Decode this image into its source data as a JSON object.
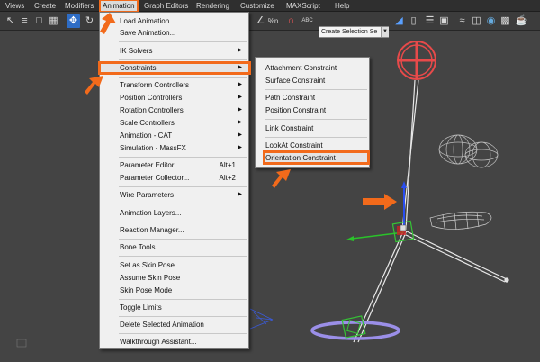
{
  "menubar": {
    "items": [
      "Views",
      "Create",
      "Modifiers",
      "Animation",
      "Graph Editors",
      "Rendering",
      "Customize",
      "MAXScript",
      "Help"
    ]
  },
  "toolbar": {
    "selection_set_placeholder": "Create Selection Se",
    "icons": [
      "select-icon",
      "region-icon",
      "move-icon",
      "rotate-icon",
      "named-selection-icon",
      "mirror-icon",
      "align-icon",
      "layers-icon",
      "graphite-icon",
      "curve-editor-icon",
      "schematic-icon",
      "material-editor-icon",
      "render-setup-icon",
      "render-frame-icon",
      "render-icon"
    ],
    "percent_snap": "%n",
    "spinner_snap": "ABC"
  },
  "animation_menu": {
    "items": [
      {
        "label": "Load Animation...",
        "shortcut": "",
        "submenu": false
      },
      {
        "label": "Save Animation...",
        "shortcut": "",
        "submenu": false
      },
      {
        "label": "IK Solvers",
        "shortcut": "",
        "submenu": true
      },
      {
        "label": "Constraints",
        "shortcut": "",
        "submenu": true
      },
      {
        "label": "Transform Controllers",
        "shortcut": "",
        "submenu": true
      },
      {
        "label": "Position Controllers",
        "shortcut": "",
        "submenu": true
      },
      {
        "label": "Rotation Controllers",
        "shortcut": "",
        "submenu": true
      },
      {
        "label": "Scale Controllers",
        "shortcut": "",
        "submenu": true
      },
      {
        "label": "Animation - CAT",
        "shortcut": "",
        "submenu": true
      },
      {
        "label": "Simulation - MassFX",
        "shortcut": "",
        "submenu": true
      },
      {
        "label": "Parameter Editor...",
        "shortcut": "Alt+1",
        "submenu": false
      },
      {
        "label": "Parameter Collector...",
        "shortcut": "Alt+2",
        "submenu": false
      },
      {
        "label": "Wire Parameters",
        "shortcut": "",
        "submenu": true
      },
      {
        "label": "Animation Layers...",
        "shortcut": "",
        "submenu": false
      },
      {
        "label": "Reaction Manager...",
        "shortcut": "",
        "submenu": false
      },
      {
        "label": "Bone Tools...",
        "shortcut": "",
        "submenu": false
      },
      {
        "label": "Set as Skin Pose",
        "shortcut": "",
        "submenu": false
      },
      {
        "label": "Assume Skin Pose",
        "shortcut": "",
        "submenu": false
      },
      {
        "label": "Skin Pose Mode",
        "shortcut": "",
        "submenu": false
      },
      {
        "label": "Toggle Limits",
        "shortcut": "",
        "submenu": false
      },
      {
        "label": "Delete Selected Animation",
        "shortcut": "",
        "submenu": false
      },
      {
        "label": "Walkthrough Assistant...",
        "shortcut": "",
        "submenu": false
      }
    ],
    "highlighted": "Constraints"
  },
  "constraints_submenu": {
    "items": [
      "Attachment Constraint",
      "Surface Constraint",
      "Path Constraint",
      "Position Constraint",
      "Link Constraint",
      "LookAt Constraint",
      "Orientation Constraint"
    ],
    "highlighted": "Orientation Constraint"
  },
  "colors": {
    "accent_orange": "#f26a1b",
    "viewport_bg": "#444444",
    "menu_bg": "#f0f0f0",
    "toolbar_blue": "#2e6dc6",
    "helper_red": "#e84a4a",
    "helper_purple": "#9b8fe8",
    "bone_green": "#35c435"
  }
}
